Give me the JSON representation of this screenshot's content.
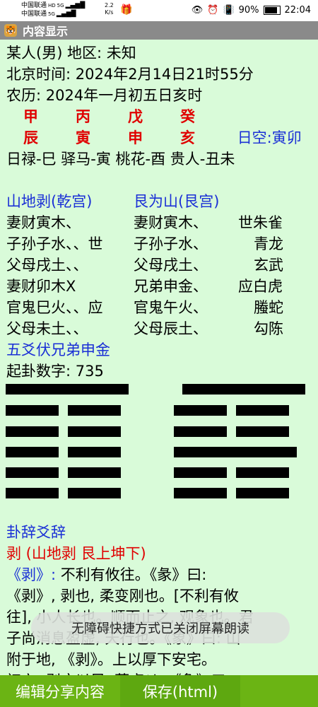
{
  "status_bar": {
    "carrier1": "中国联通",
    "carrier2": "中国联通",
    "hd": "HD",
    "net1": "5G",
    "net2": "5G",
    "speed_value": "2.2",
    "speed_unit": "K/s",
    "battery": "90%",
    "time": "22:04"
  },
  "title_bar": {
    "title": "内容显示"
  },
  "content": {
    "person": "某人(男) 地区: 未知",
    "beijing_time": "北京时间: 2024年2月14日21时55分",
    "lunar": "农历: 2024年一月初五日亥时",
    "stems": [
      "甲",
      "丙",
      "戊",
      "癸"
    ],
    "branches": [
      "辰",
      "寅",
      "申",
      "亥"
    ],
    "kongwang": "日空:寅卯",
    "shensha": "日禄-巳 驿马-寅 桃花-酉 贵人-丑未",
    "hex_main_title": "山地剥(乾宫)",
    "hex_change_title": "艮为山(艮宫)",
    "lines": [
      {
        "main": "妻财寅木、",
        "change": "妻财寅木、",
        "mark": "",
        "god": "朱雀",
        "shi": "世"
      },
      {
        "main": "子孙子水、",
        "change": "子孙子水、",
        "mark": "、世",
        "god": "青龙",
        "shi": ""
      },
      {
        "main": "父母戌土、",
        "change": "父母戌土、",
        "mark": "、",
        "god": "玄武",
        "shi": ""
      },
      {
        "main": "妻财卯木",
        "change": "兄弟申金、",
        "mark": "X",
        "god": "白虎",
        "shi": "应"
      },
      {
        "main": "官鬼巳火、",
        "change": "官鬼午火、",
        "mark": "、应",
        "god": "螣蛇",
        "shi": ""
      },
      {
        "main": "父母未土、",
        "change": "父母辰土、",
        "mark": "、",
        "god": "勾陈",
        "shi": ""
      }
    ],
    "fushen": "五爻伏兄弟申金",
    "qigua": "起卦数字: 735",
    "section_title": "卦辞爻辞",
    "hex_name_line": "剥 (山地剥 艮上坤下)",
    "guaci_label": "《剥》:",
    "guaci_text_1": "不利有攸往。《彖》曰:",
    "guaci_text_2": "《剥》, 剥也, 柔变刚也。[不利有攸",
    "guaci_text_3": "往],  小人长也。顺而止之, 观象也。君",
    "guaci_text_4": "子尚消息盈虚, 天行也。《象》曰: 山",
    "guaci_text_5": "附于地, 《剥》。上以厚下安宅。",
    "guaci_text_6": "初六: 剥床以足, 蔑贞凶。《象》曰:"
  },
  "toast": "无障碍快捷方式已关闭屏幕朗读",
  "bottom_bar": {
    "edit_share": "编辑分享内容",
    "save_html": "保存(html)"
  },
  "colors": {
    "background": "#d9fbd9",
    "red": "#e00000",
    "blue": "#1a2fd6",
    "bottom_bar": "#6bb414"
  }
}
